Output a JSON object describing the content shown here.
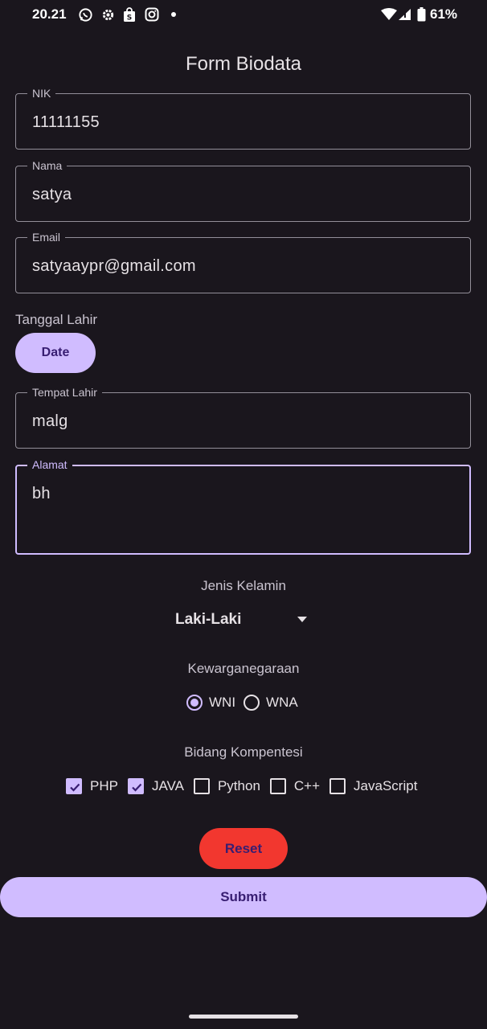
{
  "status_bar": {
    "time": "20.21",
    "battery": "61%",
    "icons": [
      "whatsapp-icon",
      "settings-icon",
      "shopping-bag-icon",
      "instagram-icon",
      "dot-icon",
      "wifi-icon",
      "signal-icon",
      "battery-icon"
    ]
  },
  "page": {
    "title": "Form Biodata"
  },
  "fields": {
    "nik": {
      "label": "NIK",
      "value": "11111155"
    },
    "nama": {
      "label": "Nama",
      "value": "satya"
    },
    "email": {
      "label": "Email",
      "value": "satyaaypr@gmail.com"
    },
    "tempat_lahir": {
      "label": "Tempat Lahir",
      "value": "malg"
    },
    "alamat": {
      "label": "Alamat",
      "value": "bh"
    }
  },
  "tanggal_lahir": {
    "label": "Tanggal Lahir",
    "button_label": "Date"
  },
  "jenis_kelamin": {
    "label": "Jenis Kelamin",
    "selected": "Laki-Laki"
  },
  "kewarganegaraan": {
    "label": "Kewarganegaraan",
    "options": [
      {
        "label": "WNI",
        "checked": true
      },
      {
        "label": "WNA",
        "checked": false
      }
    ]
  },
  "bidang_kompetensi": {
    "label": "Bidang Kompentesi",
    "options": [
      {
        "label": "PHP",
        "checked": true
      },
      {
        "label": "JAVA",
        "checked": true
      },
      {
        "label": "Python",
        "checked": false
      },
      {
        "label": "C++",
        "checked": false
      },
      {
        "label": "JavaScript",
        "checked": false
      }
    ]
  },
  "actions": {
    "reset_label": "Reset",
    "submit_label": "Submit"
  },
  "colors": {
    "background": "#1a161d",
    "accent": "#d0bcff",
    "on_accent": "#381e72",
    "reset": "#f2372f"
  }
}
